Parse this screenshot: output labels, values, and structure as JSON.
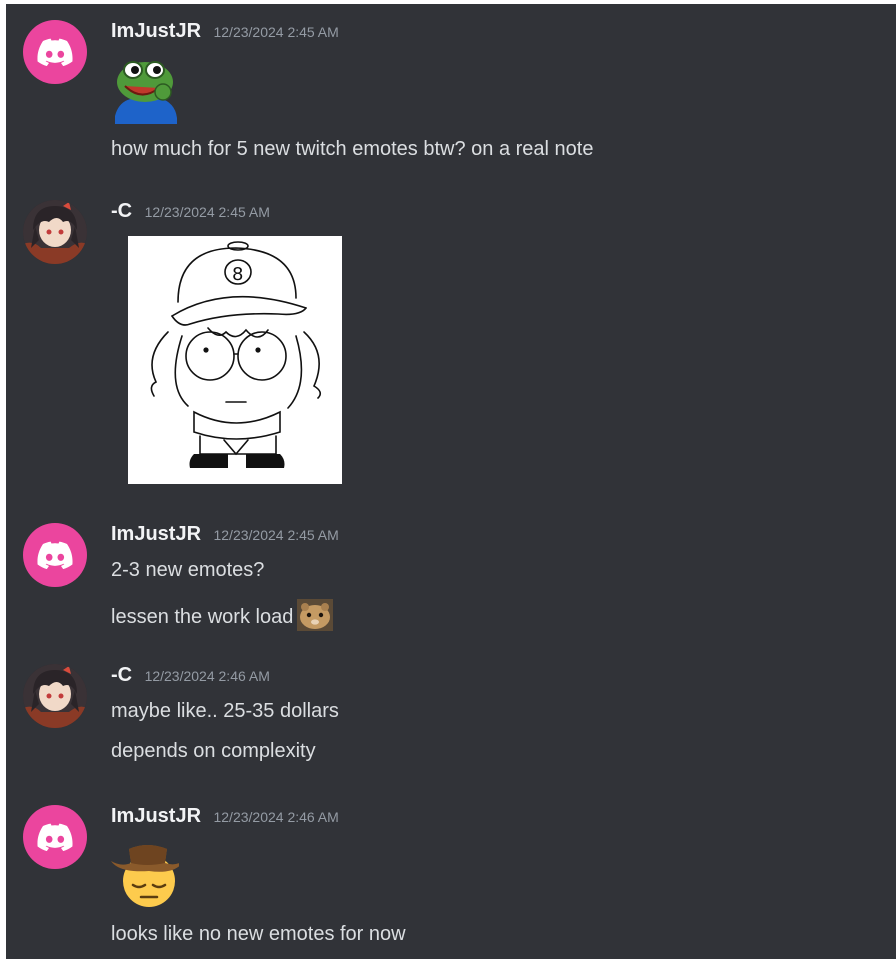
{
  "messages": [
    {
      "author": "ImJustJR",
      "timestamp": "12/23/2024 2:45 AM",
      "avatar": "discord-logo-icon",
      "emoji": "pepe-laugh-emoji",
      "lines": [
        "how much for 5 new  twitch emotes btw? on a real note"
      ]
    },
    {
      "author": "-C",
      "timestamp": "12/23/2024 2:45 AM",
      "avatar": "anime-character-avatar",
      "attachment": "character-sketch-image"
    },
    {
      "author": "ImJustJR",
      "timestamp": "12/23/2024 2:45 AM",
      "avatar": "discord-logo-icon",
      "lines": [
        "2-3 new emotes?",
        "lessen the work load"
      ],
      "inline_emoji": "hamster-emoji"
    },
    {
      "author": "-C",
      "timestamp": "12/23/2024 2:46 AM",
      "avatar": "anime-character-avatar",
      "lines": [
        "maybe like.. 25-35 dollars",
        "depends on complexity"
      ]
    },
    {
      "author": "ImJustJR",
      "timestamp": "12/23/2024 2:46 AM",
      "avatar": "discord-logo-icon",
      "emoji": "cowboy-pensive-emoji",
      "lines": [
        "looks like no new emotes for now"
      ]
    }
  ],
  "colors": {
    "background": "#313338",
    "username": "#f2f3f5",
    "timestamp": "#949ba4",
    "text": "#dbdee1",
    "discord_avatar": "#eb459e"
  }
}
